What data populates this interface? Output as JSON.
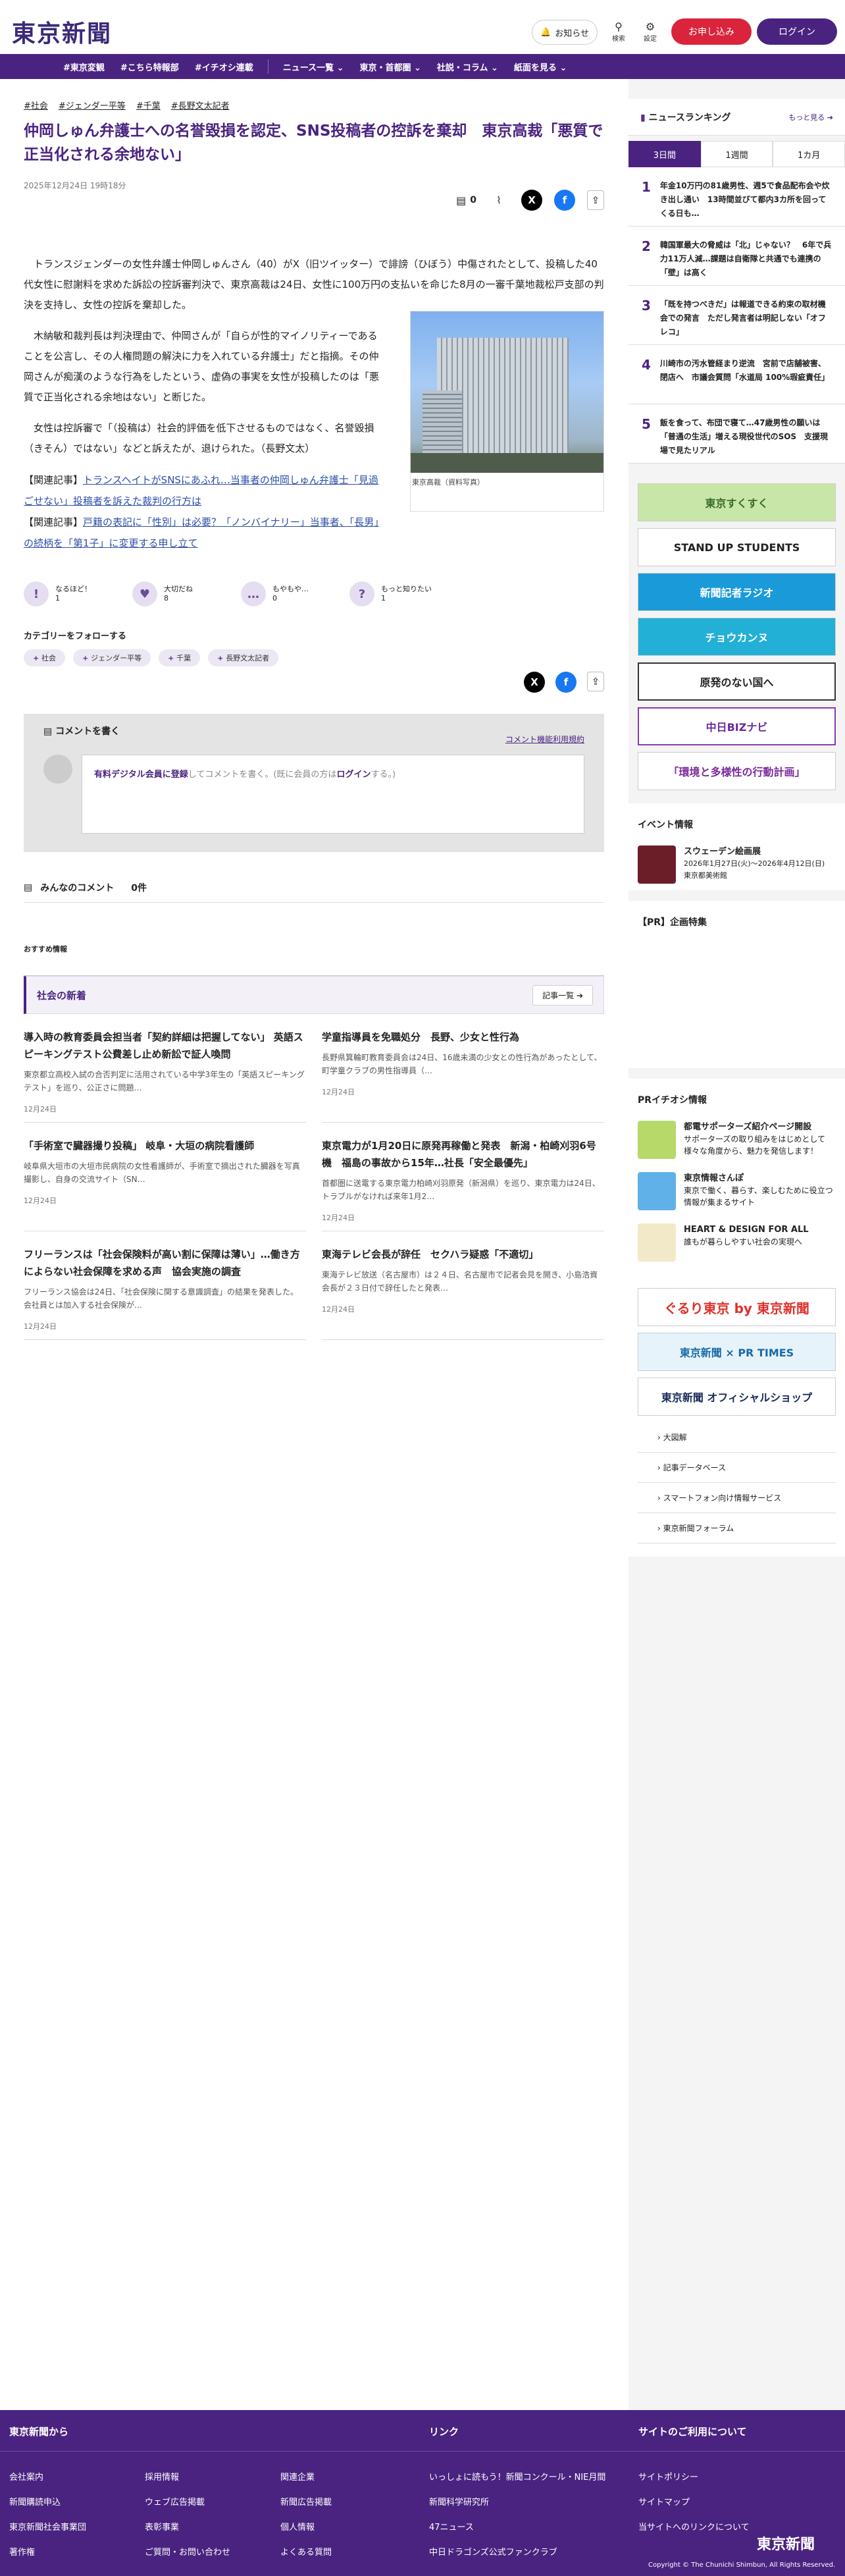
{
  "header": {
    "logo": "東京新聞",
    "notify": "お知らせ",
    "search": "検索",
    "settings": "設定",
    "register": "お申し込み",
    "login": "ログイン"
  },
  "nav": [
    "#東京変観",
    "#こちら特報部",
    "#イチオシ連載",
    "ニュース一覧 ⌄",
    "東京・首都圏 ⌄",
    "社説・コラム ⌄",
    "紙面を見る ⌄"
  ],
  "article": {
    "tags": [
      "#社会",
      "#ジェンダー平等",
      "#千葉",
      "#長野文太記者"
    ],
    "title": "仲岡しゅん弁護士への名誉毀損を認定、SNS投稿者の控訴を棄却　東京高裁「悪質で正当化される余地ない」",
    "date": "2025年12月24日 19時18分",
    "comment_count": "0",
    "p1": "トランスジェンダーの女性弁護士仲岡しゅんさん（40）がX（旧ツイッター）で誹謗（ひぼう）中傷されたとして、投稿した40代女性に慰謝料を求めた訴訟の控訴審判決で、東京高裁は24日、女性に100万円の支払いを命じた8月の一審千葉地裁松戸支部の判決を支持し、女性の控訴を棄却した。",
    "p2": "木納敏和裁判長は判決理由で、仲岡さんが「自らが性的マイノリティーであることを公言し、その人権問題の解決に力を入れている弁護士」だと指摘。その仲岡さんが痴漢のような行為をしたという、虚偽の事実を女性が投稿したのは「悪質で正当化される余地はない」と断じた。",
    "p3": "女性は控訴審で「（投稿は）社会的評価を低下させるものではなく、名誉毀損（きそん）ではない」などと訴えたが、退けられた。（長野文太）",
    "rel1_label": "【関連記事】",
    "rel1": "トランスヘイトがSNSにあふれ…当事者の仲岡しゅん弁護士「見過ごせない」投稿者を訴えた裁判の行方は",
    "rel2_label": "【関連記事】",
    "rel2": "戸籍の表記に「性別」は必要？「ノンバイナリー」当事者、「長男」の続柄を「第1子」に変更する申し立て",
    "fig_caption": "東京高裁（資料写真）",
    "reactions": [
      {
        "icon": "!",
        "label": "なるほど！",
        "count": "1"
      },
      {
        "icon": "♥",
        "label": "大切だね",
        "count": "8"
      },
      {
        "icon": "…",
        "label": "もやもや…",
        "count": "0"
      },
      {
        "icon": "?",
        "label": "もっと知りたい",
        "count": "1"
      }
    ],
    "follow_label": "カテゴリーをフォローする",
    "follow_tags": [
      "社会",
      "ジェンダー平等",
      "千葉",
      "長野文太記者"
    ]
  },
  "comments": {
    "heading": "コメントを書く",
    "rules": "コメント機能利用規約",
    "prompt_link": "有料デジタル会員に登録",
    "prompt_text": "してコメントを書く。(既に会員の方は",
    "prompt_login": "ログイン",
    "prompt_end": "する。)",
    "all": "みんなのコメント",
    "count": "0件"
  },
  "recommend": "おすすめ情報",
  "social": {
    "title": "社会の新着",
    "more": "記事一覧 ➔",
    "items": [
      {
        "title": "導入時の教育委員会担当者「契約詳細は把握してない」 英語スピーキングテスト公費差し止め新訟で証人喚問",
        "desc": "東京都立高校入試の合否判定に活用されている中学3年生の「英語スピーキングテスト」を巡り、公正さに問題…",
        "date": "12月24日"
      },
      {
        "title": "学童指導員を免職処分　長野、少女と性行為",
        "desc": "長野県箕輪町教育委員会は24日、16歳未満の少女との性行為があったとして、町学童クラブの男性指導員（…",
        "date": "12月24日"
      },
      {
        "title": "「手術室で臓器撮り投稿」 岐阜・大垣の病院看護師",
        "desc": "岐阜県大垣市の大垣市民病院の女性看護師が、手術室で摘出された臓器を写真撮影し、自身の交流サイト（SN…",
        "date": "12月24日"
      },
      {
        "title": "東京電力が1月20日に原発再稼働と発表　新潟・柏崎刈羽6号機　福島の事故から15年…社長「安全最優先」",
        "desc": "首都圏に送電する東京電力柏崎刈羽原発（新潟県）を巡り、東京電力は24日、トラブルがなければ来年1月2…",
        "date": "12月24日"
      },
      {
        "title": "フリーランスは「社会保険料が高い割に保障は薄い」…働き方によらない社会保障を求める声　協会実施の調査",
        "desc": "フリーランス協会は24日、「社会保険に関する意識調査」の結果を発表した。会社員とは加入する社会保険が…",
        "date": "12月24日"
      },
      {
        "title": "東海テレビ会長が辞任　セクハラ疑惑「不適切」",
        "desc": "東海テレビ放送（名古屋市）は２４日、名古屋市で記者会見を開き、小島浩資会長が２３日付で辞任したと発表…",
        "date": "12月24日"
      }
    ]
  },
  "side": {
    "ranking_title": "ニュースランキング",
    "ranking_more": "もっと見る ➔",
    "tabs": [
      "3日間",
      "1週間",
      "1カ月"
    ],
    "ranks": [
      {
        "n": "1",
        "t": "年金10万円の81歳男性、週5で食品配布会や炊き出し通い　13時間並びて都内3カ所を回ってくる日も…"
      },
      {
        "n": "2",
        "t": "韓国軍最大の脅威は「北」じゃない？　6年で兵力11万人減…課題は自衛隊と共通でも連携の「壁」は高く"
      },
      {
        "n": "3",
        "t": "「既を持つべきだ」は報道できる約束の取材機会での発言　ただし発言者は明記しない「オフレコ」"
      },
      {
        "n": "4",
        "t": "川崎市の汚水管経まり逆流　宮前で店舗被害、閉店へ　市議会質問「水道局 100%瑕疵責任」"
      },
      {
        "n": "5",
        "t": "飯を食って、布団で寝て…47歳男性の願いは「普通の生活」増える現役世代のSOS　支援現場で見たリアル"
      }
    ],
    "banners": [
      "東京すくすく",
      "STAND UP STUDENTS",
      "新聞記者ラジオ",
      "チョウカンヌ",
      "原発のない国へ",
      "中日BIZナビ",
      "「環境と多様性の行動計画」"
    ],
    "event_title": "イベント情報",
    "event_name": "スウェーデン絵画展",
    "event_date": "2026年1月27日(火)〜2026年4月12日(日)　東京都美術館",
    "pr_title": "【PR】企画特集",
    "ichioshi_title": "PRイチオシ情報",
    "ichioshi": [
      {
        "t": "都電サポーターズ紹介ページ開設",
        "d": "サポーターズの取り組みをはじめとして様々な角度から、魅力を発信します！"
      },
      {
        "t": "東京情報さんぽ",
        "d": "東京で働く、暮らす、楽しむために役立つ情報が集まるサイト"
      },
      {
        "t": "HEART & DESIGN FOR ALL",
        "d": "誰もが暮らしやすい社会の実現へ"
      }
    ],
    "ads": [
      "ぐるり東京 by 東京新聞",
      "東京新聞 × PR TIMES",
      "東京新聞 オフィシャルショップ"
    ],
    "links": [
      "大図解",
      "記事データベース",
      "スマートフォン向け情報サービス",
      "東京新聞フォーラム"
    ]
  },
  "footer": {
    "h1": "東京新聞から",
    "h2": "リンク",
    "h3": "サイトのご利用について",
    "c1": [
      "会社案内",
      "新聞購読申込",
      "東京新聞社会事業団",
      "著作権"
    ],
    "c2": [
      "採用情報",
      "ウェブ広告掲載",
      "表彰事業",
      "ご質問・お問い合わせ"
    ],
    "c3": [
      "関連企業",
      "新聞広告掲載",
      "個人情報",
      "よくある質問"
    ],
    "c4": [
      "いっしょに読もう！新聞コンクール・NIE月間",
      "新聞科学研究所",
      "47ニュース",
      "中日ドラゴンズ公式ファンクラブ"
    ],
    "c5": [
      "サイトポリシー",
      "サイトマップ",
      "当サイトへのリンクについて"
    ],
    "logo": "東京新聞",
    "copy": "Copyright © The Chunichi Shimbun, All Rights Reserved."
  }
}
